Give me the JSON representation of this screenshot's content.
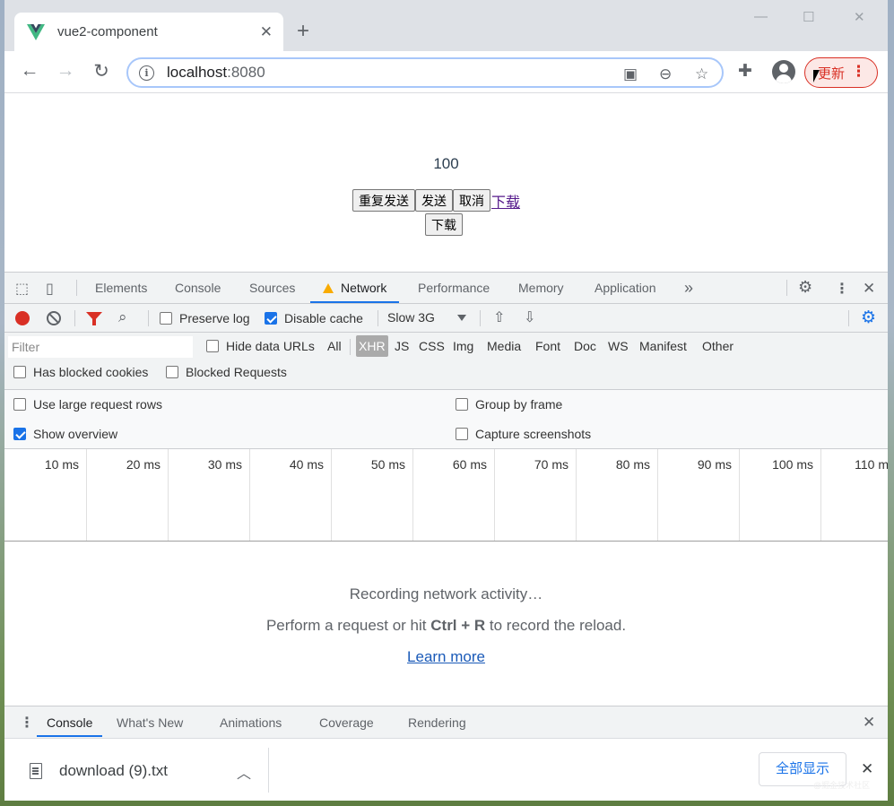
{
  "browser": {
    "tab_title": "vue2-component",
    "url_host": "localhost",
    "url_port": ":8080",
    "update_label": "更新",
    "window_controls": [
      "—",
      "☐",
      "✕"
    ]
  },
  "page": {
    "counter": "100",
    "buttons": [
      "重复发送",
      "发送",
      "取消"
    ],
    "link_download": "下载",
    "button_download": "下载"
  },
  "devtools": {
    "tabs": [
      "Elements",
      "Console",
      "Sources",
      "Network",
      "Performance",
      "Memory",
      "Application"
    ],
    "active_tab": "Network",
    "more_tabs": "»",
    "toolbar": {
      "preserve_log": "Preserve log",
      "disable_cache": "Disable cache",
      "throttle": "Slow 3G",
      "preserve_log_checked": false,
      "disable_cache_checked": true
    },
    "filter": {
      "placeholder": "Filter",
      "hide_data_urls": "Hide data URLs",
      "types": [
        "All",
        "XHR",
        "JS",
        "CSS",
        "Img",
        "Media",
        "Font",
        "Doc",
        "WS",
        "Manifest",
        "Other"
      ],
      "active_type": "XHR",
      "has_blocked_cookies": "Has blocked cookies",
      "blocked_requests": "Blocked Requests"
    },
    "settings": {
      "large_rows": "Use large request rows",
      "group_by_frame": "Group by frame",
      "show_overview": "Show overview",
      "capture_screenshots": "Capture screenshots",
      "show_overview_checked": true
    },
    "timeline_ticks": [
      "10 ms",
      "20 ms",
      "30 ms",
      "40 ms",
      "50 ms",
      "60 ms",
      "70 ms",
      "80 ms",
      "90 ms",
      "100 ms",
      "110 ms"
    ],
    "empty_state": {
      "line1": "Recording network activity…",
      "line2_pre": "Perform a request or hit ",
      "line2_keys": "Ctrl + R",
      "line2_post": " to record the reload.",
      "learn_more": "Learn more"
    },
    "drawer_tabs": [
      "Console",
      "What's New",
      "Animations",
      "Coverage",
      "Rendering"
    ]
  },
  "downloads": {
    "file_name": "download (9).txt",
    "show_all": "全部显示"
  },
  "watermark": "@掘金技术社区"
}
